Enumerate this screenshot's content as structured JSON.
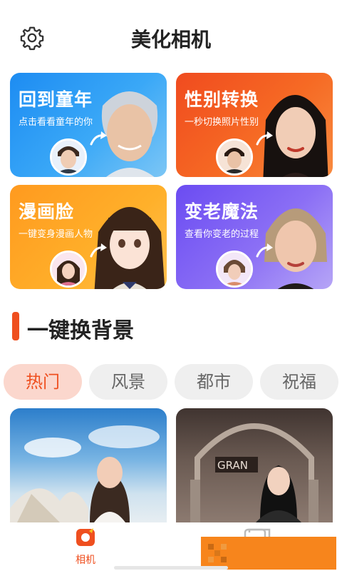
{
  "header": {
    "title": "美化相机"
  },
  "cards": [
    {
      "title": "回到童年",
      "subtitle": "点击看看童年的你"
    },
    {
      "title": "性别转换",
      "subtitle": "一秒切换照片性别"
    },
    {
      "title": "漫画脸",
      "subtitle": "一键变身漫画人物"
    },
    {
      "title": "变老魔法",
      "subtitle": "查看你变老的过程"
    }
  ],
  "section": {
    "title": "一键换背景"
  },
  "chips": [
    {
      "label": "热门",
      "active": true
    },
    {
      "label": "风景",
      "active": false
    },
    {
      "label": "都市",
      "active": false
    },
    {
      "label": "祝福",
      "active": false
    }
  ],
  "scenes": [
    {
      "sign": ""
    },
    {
      "sign": "GRAN"
    }
  ],
  "tabbar": {
    "camera_label": "相机"
  },
  "colors": {
    "accent": "#ef4f1f",
    "chip_active_bg": "#fbd7cd",
    "ad": "#f7851c"
  },
  "icons": {
    "settings": "gear-icon",
    "camera_tab": "camera-tab-icon",
    "gallery_tab": "gallery-tab-icon"
  }
}
